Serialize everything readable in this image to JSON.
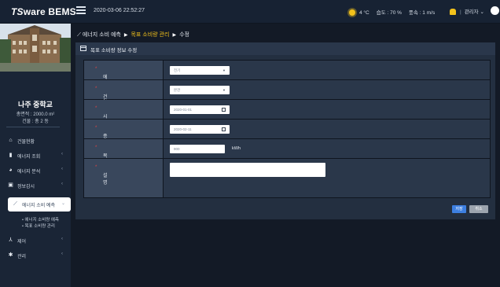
{
  "topbar": {
    "brand_part1": "TS",
    "brand_part2": "ware BEMS",
    "datetime": "2020-03-06 22:52:27",
    "temperature": "4 °C",
    "humidity": "습도 : 70 %",
    "wind": "풍속 : 1 m/s",
    "user_label": "관리자",
    "icons": [
      "menu-icon",
      "sun-icon",
      "bell-icon",
      "chevron-down-icon",
      "user-avatar-icon"
    ],
    "accent_color": "#f3c21b"
  },
  "sidebar": {
    "school_name": "나주 중학교",
    "area": "총면적 : 2000.0 m²",
    "floors": "건물 : 총 2 동",
    "items": [
      {
        "label": "건물현황",
        "icon": "home-icon",
        "chevron": ""
      },
      {
        "label": "에너지 조회",
        "icon": "bar-chart-icon",
        "chevron": "‹"
      },
      {
        "label": "에너지 분석",
        "icon": "pie-chart-icon",
        "chevron": "‹"
      },
      {
        "label": "정보감시",
        "icon": "monitor-icon",
        "chevron": "‹"
      },
      {
        "label": "에너지 소비 예측",
        "icon": "line-chart-icon",
        "chevron": "⌄"
      },
      {
        "label": "제어",
        "icon": "control-icon",
        "chevron": "‹"
      },
      {
        "label": "관리",
        "icon": "gear-icon",
        "chevron": "‹"
      }
    ],
    "subitems": [
      "• 에너지 소비량 예측",
      "• 목표 소비량 관리"
    ]
  },
  "main": {
    "breadcrumb": {
      "root": "에너지 소비 예측",
      "current": "목표 소비량 관리",
      "leaf": "수정"
    },
    "panel_title": "목표 소비량 정보 수정",
    "form": {
      "source_label": "에너지원",
      "source_value": "전기",
      "building_label": "건물",
      "building_value": "본관",
      "start_label": "시작일",
      "start_value": "2020-01-01",
      "end_label": "종료일",
      "end_value": "2020-02-11",
      "target_label": "목표 소비량",
      "target_value": "900",
      "target_unit": "kWh",
      "desc_label": "설명",
      "desc_value": "",
      "required_mark": "*"
    },
    "save_label": "저장",
    "cancel_label": "취소",
    "save_color": "#3d7fe0"
  }
}
